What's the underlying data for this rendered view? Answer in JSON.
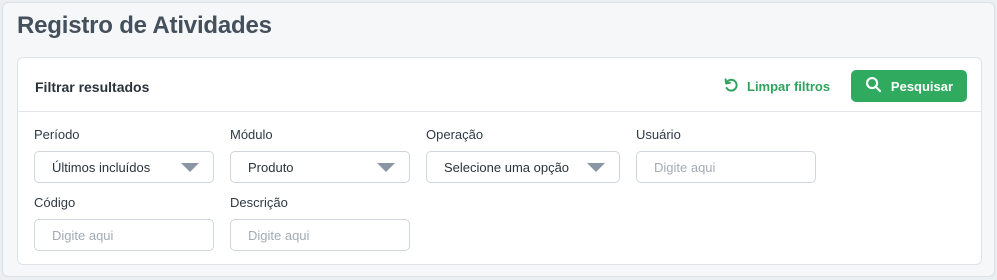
{
  "page": {
    "title": "Registro de Atividades"
  },
  "filter_card": {
    "title": "Filtrar resultados",
    "clear_label": "Limpar filtros",
    "search_label": "Pesquisar"
  },
  "filters": {
    "periodo": {
      "label": "Período",
      "value": "Últimos incluídos"
    },
    "modulo": {
      "label": "Módulo",
      "value": "Produto"
    },
    "operacao": {
      "label": "Operação",
      "value": "Selecione uma opção"
    },
    "usuario": {
      "label": "Usuário",
      "placeholder": "Digite aqui"
    },
    "codigo": {
      "label": "Código",
      "placeholder": "Digite aqui"
    },
    "descricao": {
      "label": "Descrição",
      "placeholder": "Digite aqui"
    }
  },
  "colors": {
    "accent_green": "#2faa5f",
    "link_green": "#2fa35e"
  },
  "icons": {
    "clear": "refresh-icon",
    "search": "search-icon",
    "dropdown": "caret-down-icon"
  }
}
